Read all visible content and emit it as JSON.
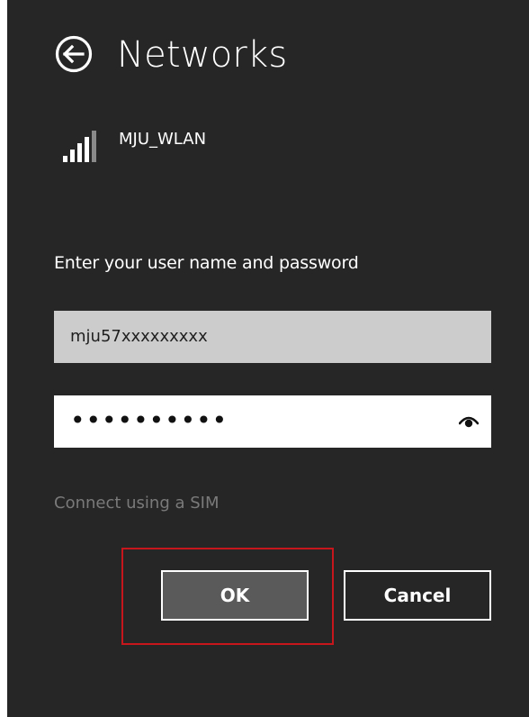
{
  "header": {
    "title": "Networks",
    "back_icon": "back-arrow-circle-icon"
  },
  "network": {
    "name": "MJU_WLAN",
    "signal_icon": "wifi-signal-icon"
  },
  "form": {
    "prompt": "Enter your user name and password",
    "username_value": "mju57xxxxxxxxx",
    "password_masked": "••••••••••",
    "reveal_icon": "eye-icon",
    "sim_link": "Connect using a SIM"
  },
  "buttons": {
    "ok_label": "OK",
    "cancel_label": "Cancel"
  },
  "colors": {
    "panel_background": "#262626",
    "username_field": "#cccccc",
    "password_field": "#ffffff",
    "ok_button": "#5a5a5a",
    "sim_link_text": "#7a7a7a",
    "highlight": "#c8161d"
  }
}
